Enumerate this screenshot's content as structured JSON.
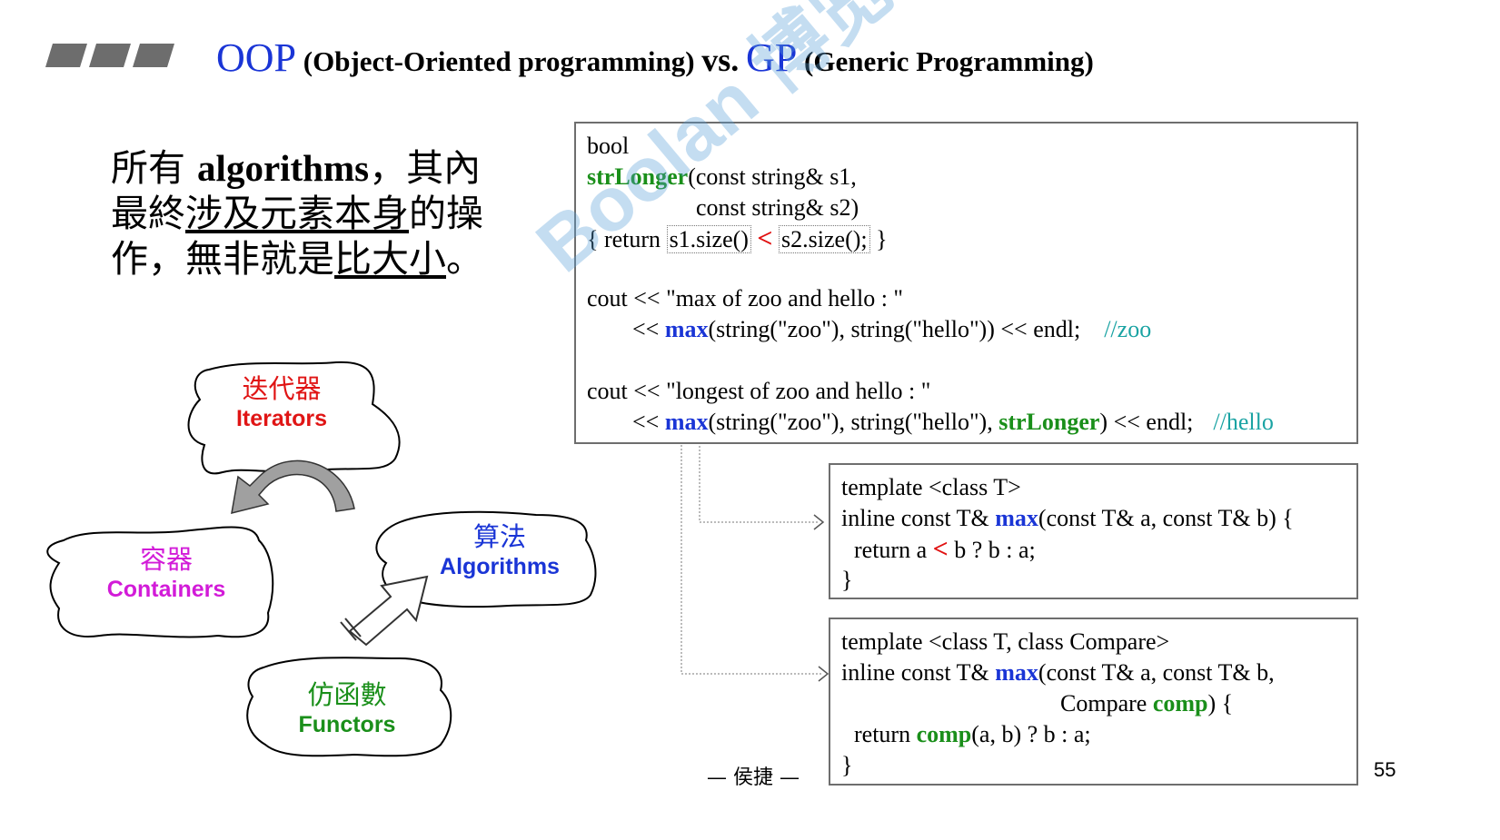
{
  "title": {
    "oop": "OOP",
    "oop_desc": "(Object-Oriented programming)",
    "vs": "vs.",
    "gp": "GP",
    "gp_desc": "(Generic Programming)"
  },
  "intro": {
    "p1": "所有 ",
    "p2": "algorithms",
    "p3": "，其內最終",
    "p4": "涉及元素本身",
    "p5": "的操作，無非就是",
    "p6": "比大小",
    "p7": "。"
  },
  "clouds": {
    "iterators": {
      "zh": "迭代器",
      "en": "Iterators",
      "color": "#e01515"
    },
    "containers": {
      "zh": "容器",
      "en": "Containers",
      "color": "#d21bd8"
    },
    "algorithms": {
      "zh": "算法",
      "en": "Algorithms",
      "color": "#1a35d6"
    },
    "functors": {
      "zh": "仿函數",
      "en": "Functors",
      "color": "#1a8f1a"
    }
  },
  "code1": {
    "l1": "bool",
    "l2_fn": "strLonger",
    "l2_rest": "(const string& s1,",
    "l3": "const string& s2)",
    "l4_a": "{  return ",
    "l4_b": "s1.size()",
    "l4_op": "<",
    "l4_c": "s2.size();",
    "l4_d": " }",
    "l5": "cout << \"max of zoo and hello : \"",
    "l6_a": "<< ",
    "l6_fn": "max",
    "l6_b": "(string(\"zoo\"), string(\"hello\")) << endl;",
    "l6_cm": "//zoo",
    "l7": "cout << \"longest of zoo and hello : \"",
    "l8_a": "<< ",
    "l8_fn": "max",
    "l8_b": "(string(\"zoo\"), string(\"hello\"), ",
    "l8_fn2": "strLonger",
    "l8_c": ") << endl;",
    "l8_cm": "//hello"
  },
  "code2": {
    "l1": "template <class T>",
    "l2_a": "inline const T& ",
    "l2_fn": "max",
    "l2_b": "(const T& a, const T& b) {",
    "l3_a": "return  a ",
    "l3_op": "<",
    "l3_b": " b ? b : a;",
    "l4": "}"
  },
  "code3": {
    "l1": "template <class T, class Compare>",
    "l2_a": "inline const T& ",
    "l2_fn": "max",
    "l2_b": "(const T& a, const T& b,",
    "l3_a": "Compare ",
    "l3_fn": "comp",
    "l3_b": ") {",
    "l4_a": "return ",
    "l4_fn": "comp",
    "l4_b": "(a, b) ? b : a;",
    "l5": "}"
  },
  "footer": {
    "author": "— 侯捷 —",
    "page": "55"
  },
  "watermark": {
    "text": "Boolan 博览网"
  }
}
